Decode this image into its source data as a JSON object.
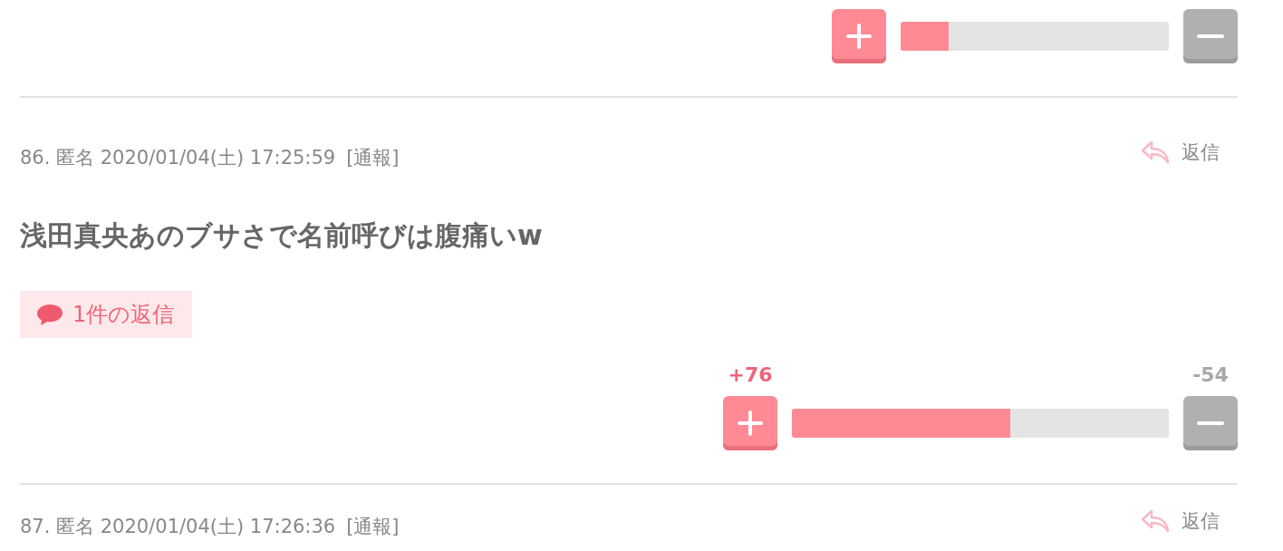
{
  "comments": [
    {
      "vote": {
        "level": 0.18
      }
    },
    {
      "meta": "86. 匿名 2020/01/04(土) 17:25:59",
      "report": "[通報]",
      "reply_label": "返信",
      "body": "浅田真央あのブサさで名前呼びは腹痛いw",
      "reply_count": "1件の返信",
      "vote": {
        "plus_count": "+76",
        "minus_count": "-54",
        "level": 0.58
      }
    },
    {
      "meta": "87. 匿名 2020/01/04(土) 17:26:36",
      "report": "[通報]",
      "reply_label": "返信"
    }
  ]
}
